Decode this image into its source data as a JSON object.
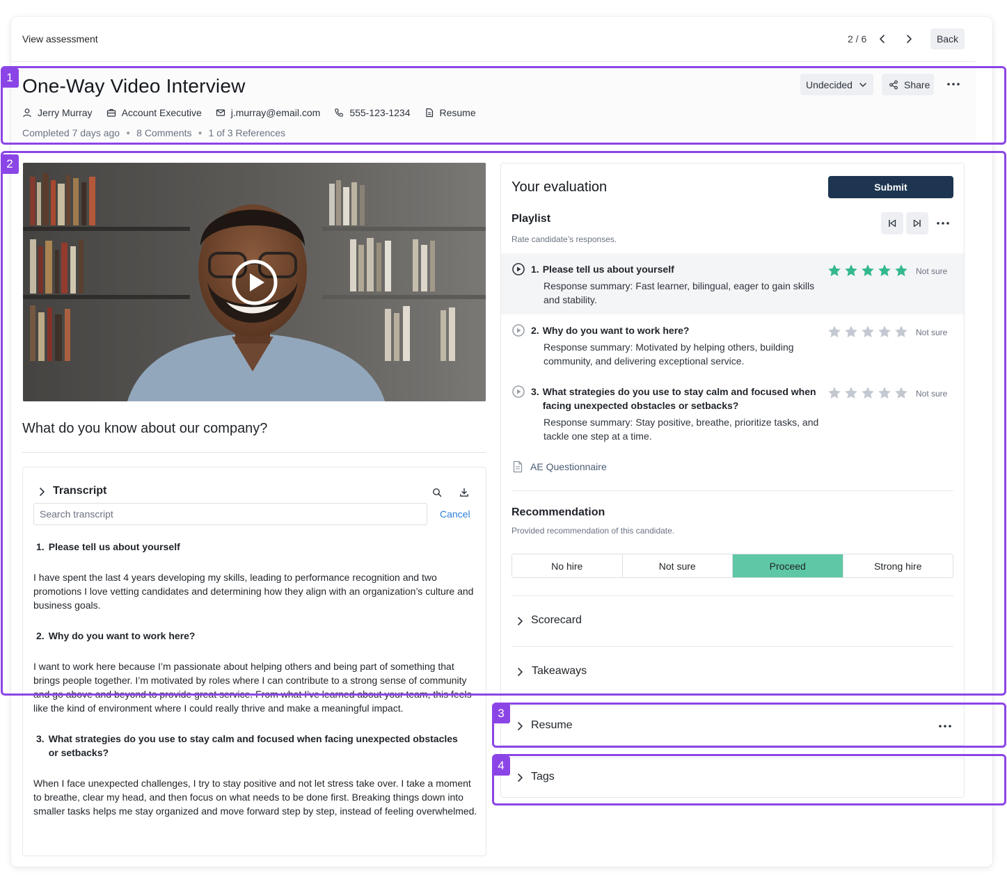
{
  "topbar": {
    "title": "View assessment",
    "pager": "2 / 6",
    "back_label": "Back"
  },
  "header": {
    "title": "One-Way Video Interview",
    "decision_label": "Undecided",
    "share_label": "Share",
    "candidate": {
      "name": "Jerry Murray",
      "role": "Account Executive",
      "email": "j.murray@email.com",
      "phone": "555-123-1234",
      "resume_label": "Resume"
    },
    "meta": {
      "completed": "Completed 7 days ago",
      "comments": "8 Comments",
      "references": "1 of 3 References"
    }
  },
  "video": {
    "question_title": "What do you know about our company?"
  },
  "transcript": {
    "title": "Transcript",
    "search_placeholder": "Search transcript",
    "cancel_label": "Cancel",
    "entries": [
      {
        "num": "1.",
        "question": "Please tell us about yourself",
        "answer": "I have spent the last 4 years developing my skills, leading to performance recognition and two promotions I love vetting candidates and determining how they align with an organization’s culture and business goals."
      },
      {
        "num": "2.",
        "question": "Why do you want to work here?",
        "answer": "I want to work here because I’m passionate about helping others and being part of something that brings people together. I’m motivated by roles where I can contribute to a strong sense of community and go above and beyond to provide great service. From what I’ve learned about your team, this feels like the kind of environment where I could really thrive and make a meaningful impact."
      },
      {
        "num": "3.",
        "question": "What strategies do you use to stay calm and focused when facing unexpected obstacles or setbacks?",
        "answer": "When I face unexpected challenges, I try to stay positive and not let stress take over. I take a moment to breathe, clear my head, and then focus on what needs to be done first. Breaking things down into smaller tasks helps me stay organized and move forward step by step, instead of feeling overwhelmed."
      }
    ]
  },
  "evaluation": {
    "title": "Your evaluation",
    "submit_label": "Submit",
    "playlist": {
      "title": "Playlist",
      "subtitle": "Rate candidate’s responses.",
      "items": [
        {
          "num": "1.",
          "question": "Please tell us about yourself",
          "summary": "Response summary: Fast learner, bilingual, eager to gain skills and stability.",
          "rating": 5,
          "not_sure_label": "Not sure"
        },
        {
          "num": "2.",
          "question": "Why do you want to work here?",
          "summary": "Response summary: Motivated by helping others, building community, and delivering exceptional service.",
          "rating": 0,
          "not_sure_label": "Not sure"
        },
        {
          "num": "3.",
          "question": "What strategies do you use to stay calm and focused when facing unexpected obstacles or setbacks?",
          "summary": "Response summary: Stay positive, breathe, prioritize tasks, and tackle one step at a time.",
          "rating": 0,
          "not_sure_label": "Not sure"
        }
      ],
      "questionnaire_label": "AE Questionnaire"
    },
    "recommendation": {
      "title": "Recommendation",
      "subtitle": "Provided recommendation of this candidate.",
      "options": [
        "No hire",
        "Not sure",
        "Proceed",
        "Strong hire"
      ],
      "selected": "Proceed"
    },
    "sections": {
      "scorecard": "Scorecard",
      "takeaways": "Takeaways"
    }
  },
  "resume_section": {
    "title": "Resume"
  },
  "tags_section": {
    "title": "Tags"
  },
  "annotations": [
    "1",
    "2",
    "3",
    "4"
  ],
  "colors": {
    "accent_purple": "#8b45e6",
    "submit_navy": "#1d3550",
    "star_filled": "#34b88e",
    "star_empty": "#c3c8d1",
    "proceed_green": "#5ec7a5",
    "link_blue": "#2f7fd8"
  }
}
